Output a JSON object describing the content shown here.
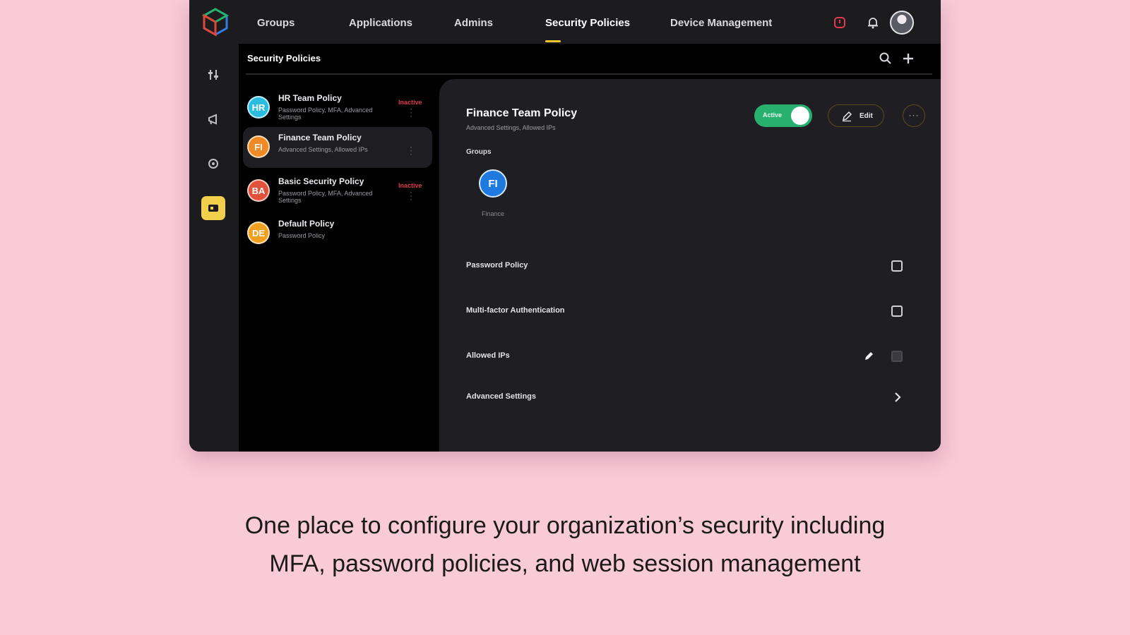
{
  "nav": {
    "items": [
      {
        "label": "Groups"
      },
      {
        "label": "Applications"
      },
      {
        "label": "Admins"
      },
      {
        "label": "Security Policies"
      },
      {
        "label": "Device Management"
      }
    ],
    "active_index": 3,
    "accent": "#f2c230"
  },
  "subheader": {
    "title": "Security Policies"
  },
  "policies": [
    {
      "initials": "HR",
      "name": "HR Team Policy",
      "desc": "Password Policy, MFA, Advanced Settings",
      "status": "Inactive",
      "color": "#2bbde0"
    },
    {
      "initials": "FI",
      "name": "Finance Team Policy",
      "desc": "Advanced Settings, Allowed IPs",
      "status": "",
      "color": "#f08a24"
    },
    {
      "initials": "BA",
      "name": "Basic Security Policy",
      "desc": "Password Policy, MFA, Advanced Settings",
      "status": "Inactive",
      "color": "#e0503a"
    },
    {
      "initials": "DE",
      "name": "Default Policy",
      "desc": "Password Policy",
      "status": "",
      "color": "#f0a020"
    }
  ],
  "detail": {
    "title": "Finance Team Policy",
    "subtitle": "Advanced Settings, Allowed IPs",
    "toggle_label": "Active",
    "toggle_color": "#27b06e",
    "edit_label": "Edit",
    "more_label": "···",
    "groups_label": "Groups",
    "group": {
      "initials": "FI",
      "name": "Finance",
      "color": "#1f7ae0"
    },
    "settings": [
      {
        "label": "Password Policy",
        "control": "checkbox",
        "checked": false
      },
      {
        "label": "Multi-factor Authentication",
        "control": "checkbox",
        "checked": false
      },
      {
        "label": "Allowed IPs",
        "control": "checkbox-edit",
        "checked": true
      },
      {
        "label": "Advanced Settings",
        "control": "chevron"
      }
    ]
  },
  "caption": {
    "line1": "One place to configure your organization’s security including",
    "line2": "MFA, password policies, and web session management"
  }
}
